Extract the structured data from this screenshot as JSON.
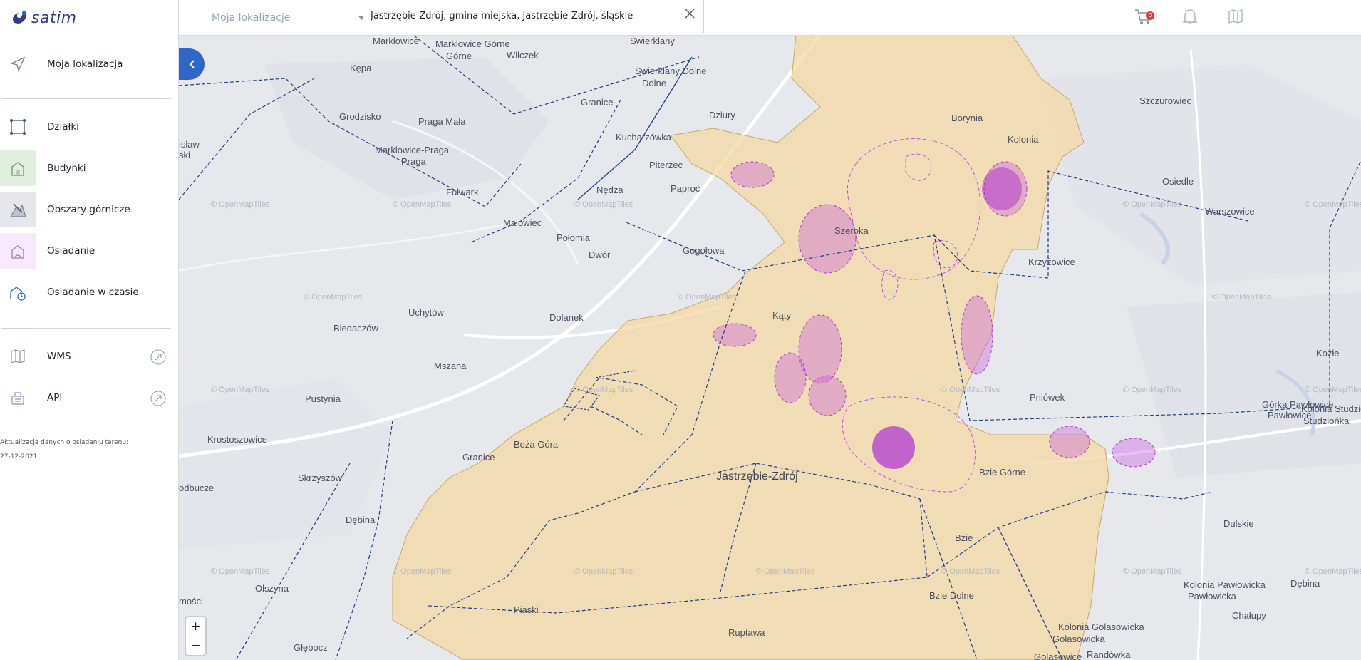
{
  "brand": {
    "name": "satim"
  },
  "sidebar": {
    "my_location": "Moja lokalizacja",
    "layers": [
      {
        "label": "Działki",
        "icon": "parcel-icon",
        "bg": "#ffffff"
      },
      {
        "label": "Budynki",
        "icon": "building-icon",
        "bg": "#dff0dc"
      },
      {
        "label": "Obszary górnicze",
        "icon": "mining-icon",
        "bg": "#e6e7eb"
      },
      {
        "label": "Osiadanie",
        "icon": "subsidence-icon",
        "bg": "#f8e8fb"
      },
      {
        "label": "Osiadanie w czasie",
        "icon": "subsidence-time-icon",
        "bg": "#ffffff"
      }
    ],
    "services": [
      {
        "label": "WMS",
        "icon": "wms-icon"
      },
      {
        "label": "API",
        "icon": "api-icon"
      }
    ],
    "update_label": "Aktualizacja danych o osiadaniu terenu:",
    "update_date": "27-12-2021"
  },
  "topbar": {
    "location_select": "Moja lokalizacje",
    "search_value": "Jastrzębie-Zdrój, gmina miejska, Jastrzębie-Zdrój, śląskie",
    "cart_count": "0"
  },
  "map": {
    "attribution": "© OpenMapTiles",
    "main_city": "Jastrzębie-Zdrój",
    "places": [
      "Marklowice",
      "Marklowice Górne",
      "Wilczek",
      "Świerklany",
      "Kępa",
      "Świerklany Dolne",
      "Grodzisko",
      "Praga Mała",
      "Granice",
      "Dziury",
      "Borynia",
      "Szczurowiec",
      "Kolonia",
      "Kucharzówka",
      "Marklowice-Praga",
      "isław",
      "ski",
      "Piterzec",
      "Osiedle",
      "Folwark",
      "Nędza",
      "Paproć",
      "Warszowice",
      "Malowiec",
      "Połomia",
      "Szeroka",
      "Dwór",
      "Gogołowa",
      "Krzyżowice",
      "Uchytów",
      "Dolanek",
      "Biedaczów",
      "Kąty",
      "Mszana",
      "Kozłe",
      "Pustynia",
      "Pniówek",
      "Górka Pawłowice",
      "Kolonia Studziońka",
      "Krostoszowice",
      "Boża Góra",
      "Granice",
      "Bzie Górne",
      "Skrzyszów",
      "odbucze",
      "Dębina",
      "Dulskie",
      "Bzie",
      "Olszyna",
      "Kolonia Pawłowicka",
      "Dębina",
      "mości",
      "Bzie Dolne",
      "Piaski",
      "Chałupy",
      "Ruptawa",
      "Kolonia Golasowicka",
      "Głębocz",
      "Golasowice",
      "Randówka"
    ]
  },
  "colors": {
    "accent": "#2f66c7",
    "city_fill": "#f3d9a4",
    "subsidence": "#c64de0",
    "boundary": "#1e3f8a"
  }
}
